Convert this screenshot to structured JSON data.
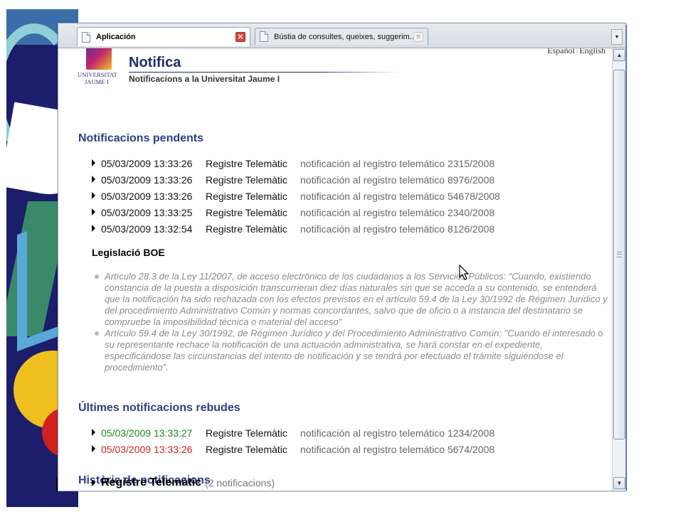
{
  "tabs": [
    {
      "label": "Aplicación",
      "active": true
    },
    {
      "label": "Bústia de consultes, queixes, suggerim...",
      "active": false
    }
  ],
  "lang": {
    "es": "Español",
    "en": "English",
    "sep": "|"
  },
  "logo": {
    "line1": "UNIVERSITAT",
    "line2": "JAUME·I"
  },
  "header": {
    "title": "Notifica",
    "subtitle": "Notificacions a la Universitat Jaume I"
  },
  "pending": {
    "title": "Notificacions pendents",
    "rows": [
      {
        "date": "05/03/2009 13:33:26",
        "registry": "Registre Telemàtic",
        "description": "notificación al registro telemático 2315/2008"
      },
      {
        "date": "05/03/2009 13:33:26",
        "registry": "Registre Telemàtic",
        "description": "notificación al registro telemático 8976/2008"
      },
      {
        "date": "05/03/2009 13:33:26",
        "registry": "Registre Telemàtic",
        "description": "notificación al registro telemático 54678/2008"
      },
      {
        "date": "05/03/2009 13:33:25",
        "registry": "Registre Telemàtic",
        "description": "notificación al registro telemático 2340/2008"
      },
      {
        "date": "05/03/2009 13:32:54",
        "registry": "Registre Telemàtic",
        "description": "notificación al registro telemático 8126/2008"
      }
    ]
  },
  "legislation": {
    "title": "Legislació BOE",
    "items": [
      "Artículo 28.3 de la Ley 11/2007, de acceso electrónico de los ciudadanos a los Servicios Públicos: \"Cuando, existiendo constancia de la puesta a disposición transcurrieran diez días naturales sin que se acceda a su contenido, se entenderá que la notificación ha sido rechazada con los efectos previstos en el artículo 59.4 de la Ley 30/1992 de Régimen Jurídico y del procedimiento Administrativo Común y normas concordantes, salvo que de oficio o a instancia del destinatario se compruebe la imposibilidad técnica o material del acceso\"",
      "Artículo 59.4 de la Ley 30/1992, de Régimen Jurídico y del Procedimiento Administrativo Común: \"Cuando el interesado o su representante rechace la notificación de una actuación administrativa, se hará constar en el expediente, especificándose las circunstancias del intento de notificación y se tendrá por efectuado el trámite siguiéndose el procedimiento\"."
    ]
  },
  "received": {
    "title": "Últimes notificacions rebudes",
    "rows": [
      {
        "date": "05/03/2009 13:33:27",
        "registry": "Registre Telemàtic",
        "description": "notificación al registro telemático 1234/2008",
        "color": "#1e8c1e"
      },
      {
        "date": "05/03/2009 13:33:26",
        "registry": "Registre Telemàtic",
        "description": "notificación al registro telemático 5674/2008",
        "color": "#cc2222"
      }
    ]
  },
  "history": {
    "title": "Històric de notificacions",
    "entry": {
      "name": "Registre Telemàtic",
      "count": "(2 notificacions)"
    }
  },
  "colors": {
    "section_title": "#2c3f85",
    "green_date": "#1e8c1e",
    "red_date": "#cc2222"
  }
}
